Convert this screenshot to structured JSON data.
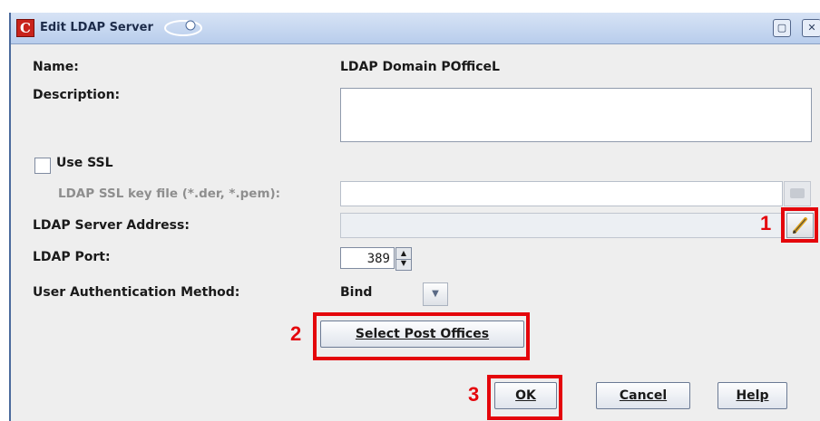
{
  "window": {
    "title": "Edit LDAP Server",
    "app_icon_letter": "C"
  },
  "form": {
    "name_label": "Name:",
    "name_value": "LDAP Domain POfficeL",
    "description_label": "Description:",
    "description_value": "",
    "use_ssl_label": "Use SSL",
    "use_ssl_checked": false,
    "ssl_key_label": "LDAP SSL key file (*.der, *.pem):",
    "ssl_key_value": "",
    "server_address_label": "LDAP Server Address:",
    "server_address_value": "",
    "port_label": "LDAP Port:",
    "port_value": "389",
    "auth_method_label": "User Authentication Method:",
    "auth_method_value": "Bind"
  },
  "buttons": {
    "select_post_offices": "Select Post Offices",
    "ok": "OK",
    "cancel": "Cancel",
    "help": "Help"
  },
  "annotations": {
    "marker_1": "1",
    "marker_2": "2",
    "marker_3": "3",
    "color": "#e4050b"
  },
  "icons": {
    "edit": "pencil-icon",
    "browse": "folder-icon",
    "maximize": "maximize-icon",
    "close": "close-icon"
  }
}
